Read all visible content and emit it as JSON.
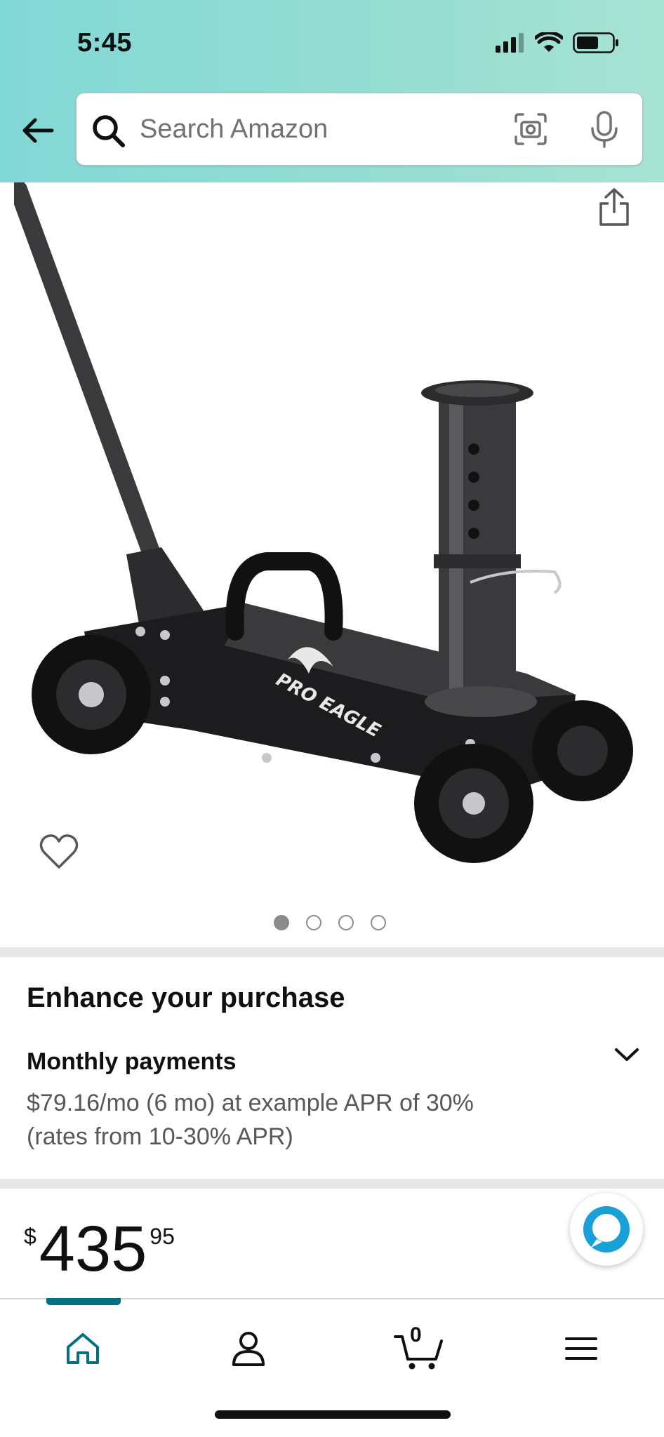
{
  "status_bar": {
    "time": "5:45"
  },
  "search": {
    "placeholder": "Search Amazon"
  },
  "product": {
    "image_alt": "Pro Eagle floor jack",
    "brand_mark": "PRO EAGLE",
    "image_count": 4,
    "active_image_index": 0
  },
  "enhance": {
    "title": "Enhance your purchase",
    "monthly_title": "Monthly payments",
    "monthly_line1": "$79.16/mo (6 mo) at example APR of 30%",
    "monthly_line2": "(rates from 10-30% APR)"
  },
  "price": {
    "symbol": "$",
    "whole": "435",
    "fraction": "95"
  },
  "nav": {
    "cart_count": "0"
  },
  "colors": {
    "accent": "#007185",
    "alexa": "#1aa0d8",
    "header_gradient_start": "#82d8d6",
    "header_gradient_end": "#a7e3d3"
  },
  "icons": [
    "back-arrow-icon",
    "search-icon",
    "camera-icon",
    "mic-icon",
    "share-icon",
    "heart-icon",
    "chevron-down-icon",
    "alexa-icon",
    "home-icon",
    "account-icon",
    "cart-icon",
    "menu-icon"
  ]
}
